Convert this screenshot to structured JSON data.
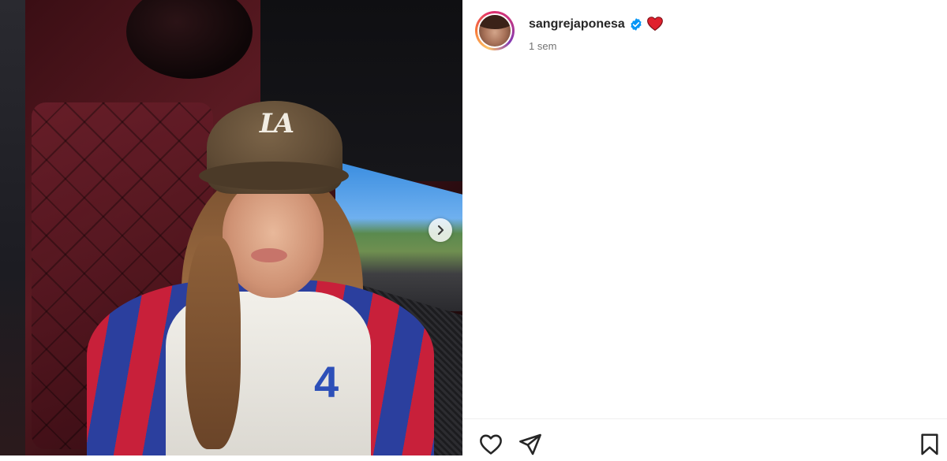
{
  "post": {
    "author": {
      "username": "sangrejaponesa",
      "verified": true,
      "badge_emoji": "heart"
    },
    "timestamp": "1 sem",
    "media": {
      "cap_logo": "LA",
      "shirt_number": "4",
      "carousel_next_icon": "chevron-right-icon"
    },
    "actions": {
      "like_icon": "heart-outline-icon",
      "share_icon": "paper-plane-icon",
      "save_icon": "bookmark-icon"
    }
  },
  "colors": {
    "verified_blue": "#0095f6",
    "heart_red": "#e0202d",
    "text_primary": "#262626",
    "text_secondary": "#737373"
  }
}
